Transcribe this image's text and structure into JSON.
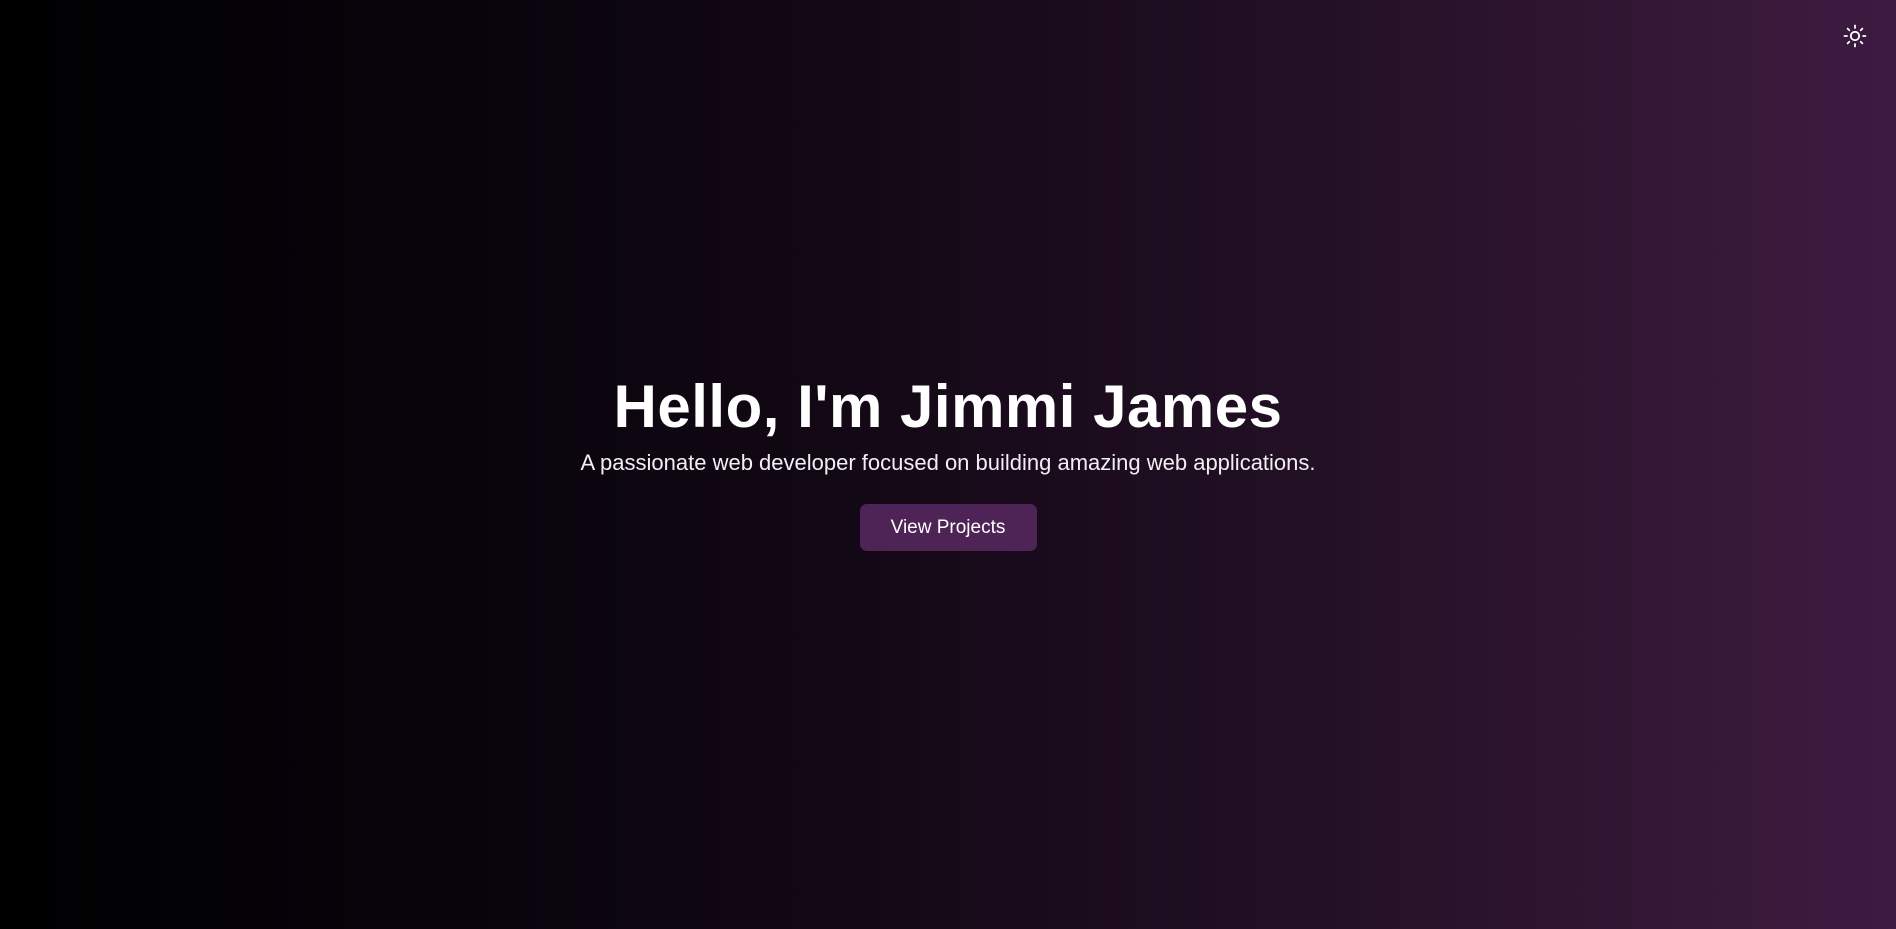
{
  "header": {
    "theme_toggle_icon": "sun-icon"
  },
  "hero": {
    "title": "Hello, I'm Jimmi James",
    "subtitle": "A passionate web developer focused on building amazing web applications.",
    "cta_label": "View Projects"
  },
  "colors": {
    "background_start": "#000000",
    "background_end": "#3d1b42",
    "button_bg": "#4e2456",
    "text": "#ffffff"
  }
}
